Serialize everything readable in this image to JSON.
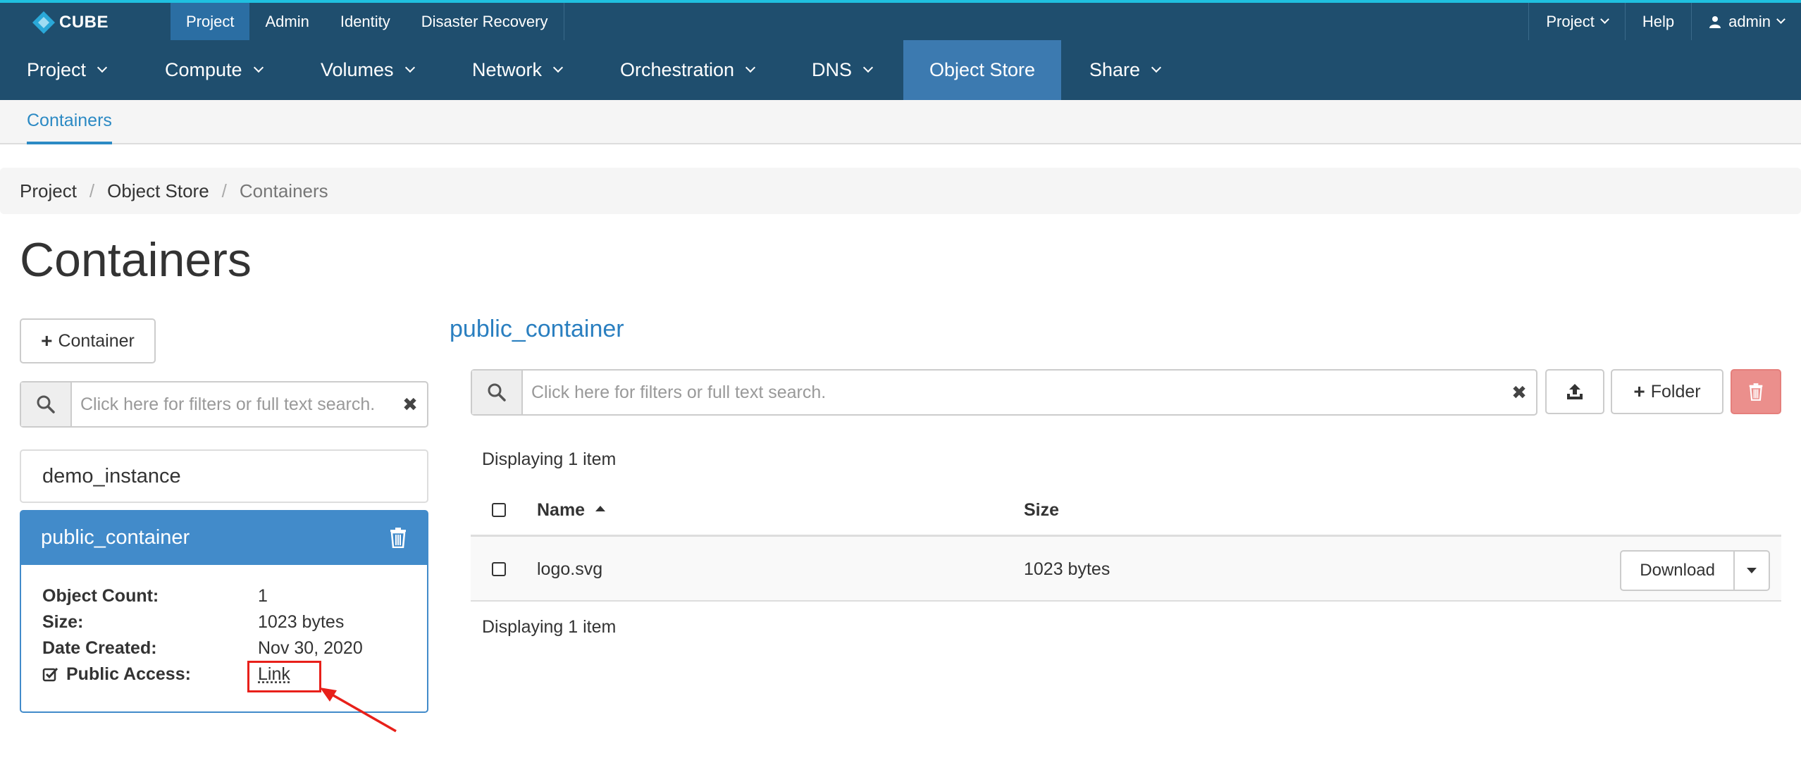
{
  "brand": {
    "logo_text": "CUBE"
  },
  "topnav": {
    "left": [
      {
        "label": "Project",
        "active": true
      },
      {
        "label": "Admin"
      },
      {
        "label": "Identity"
      },
      {
        "label": "Disaster Recovery"
      }
    ],
    "right": {
      "project": "Project",
      "help": "Help",
      "user": "admin"
    }
  },
  "mainnav": [
    {
      "label": "Project"
    },
    {
      "label": "Compute"
    },
    {
      "label": "Volumes"
    },
    {
      "label": "Network"
    },
    {
      "label": "Orchestration"
    },
    {
      "label": "DNS"
    },
    {
      "label": "Object Store",
      "active": true
    },
    {
      "label": "Share"
    }
  ],
  "subnav": {
    "tab": "Containers"
  },
  "breadcrumb": [
    "Project",
    "Object Store",
    "Containers"
  ],
  "page_title": "Containers",
  "left": {
    "add_container_label": "Container",
    "search_placeholder": "Click here for filters or full text search.",
    "containers": [
      {
        "name": "demo_instance"
      },
      {
        "name": "public_container",
        "selected": true
      }
    ],
    "details": {
      "object_count_label": "Object Count:",
      "object_count": "1",
      "size_label": "Size:",
      "size": "1023 bytes",
      "date_label": "Date Created:",
      "date": "Nov 30, 2020",
      "public_label": "Public Access:",
      "public_link": "Link"
    }
  },
  "right": {
    "container_title": "public_container",
    "search_placeholder": "Click here for filters or full text search.",
    "folder_label": "Folder",
    "displaying_top": "Displaying 1 item",
    "displaying_bottom": "Displaying 1 item",
    "columns": {
      "name": "Name",
      "size": "Size"
    },
    "rows": [
      {
        "name": "logo.svg",
        "size": "1023 bytes",
        "action": "Download"
      }
    ]
  },
  "colors": {
    "navbar": "#1f4e6e",
    "accent": "#1fc0e0",
    "primary": "#428bca",
    "danger": "#eb8f8c",
    "annotation": "#e8201a"
  }
}
